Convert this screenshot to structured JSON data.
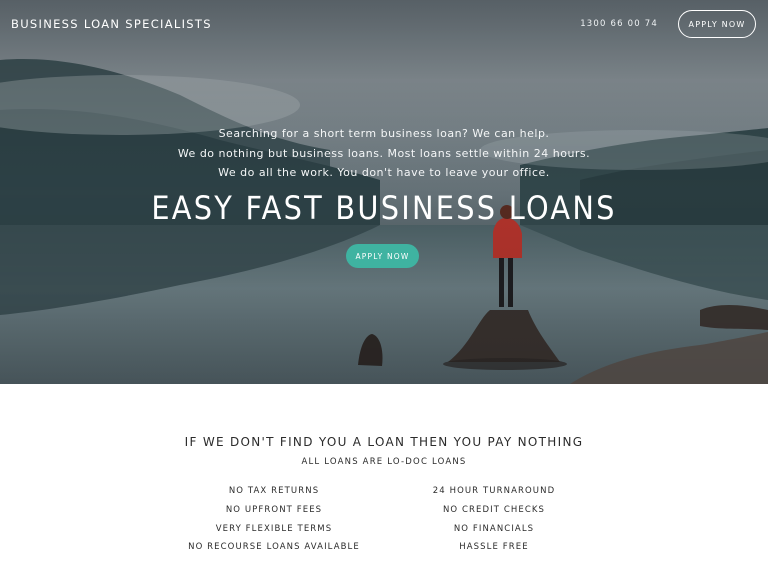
{
  "header": {
    "brand": "BUSINESS LOAN SPECIALISTS",
    "phone": "1300 66 00 74",
    "cta_label": "APPLY NOW"
  },
  "hero": {
    "lines": [
      "Searching for a short term business loan? We can help.",
      "We do nothing but business loans. Most loans settle within 24 hours.",
      "We do all the work. You don't have to leave your office."
    ],
    "title": "EASY FAST BUSINESS LOANS",
    "cta_label": "APPLY NOW",
    "cta_color": "#3fb3a1"
  },
  "info": {
    "headline": "IF WE DON'T FIND YOU A LOAN THEN YOU PAY NOTHING",
    "subhead": "ALL LOANS ARE LO-DOC LOANS",
    "features_left": [
      "NO TAX RETURNS",
      "NO UPFRONT FEES",
      "VERY FLEXIBLE TERMS",
      "NO RECOURSE LOANS AVAILABLE"
    ],
    "features_right": [
      "24 HOUR TURNAROUND",
      "NO CREDIT CHECKS",
      "NO FINANCIALS",
      "HASSLE FREE"
    ]
  }
}
